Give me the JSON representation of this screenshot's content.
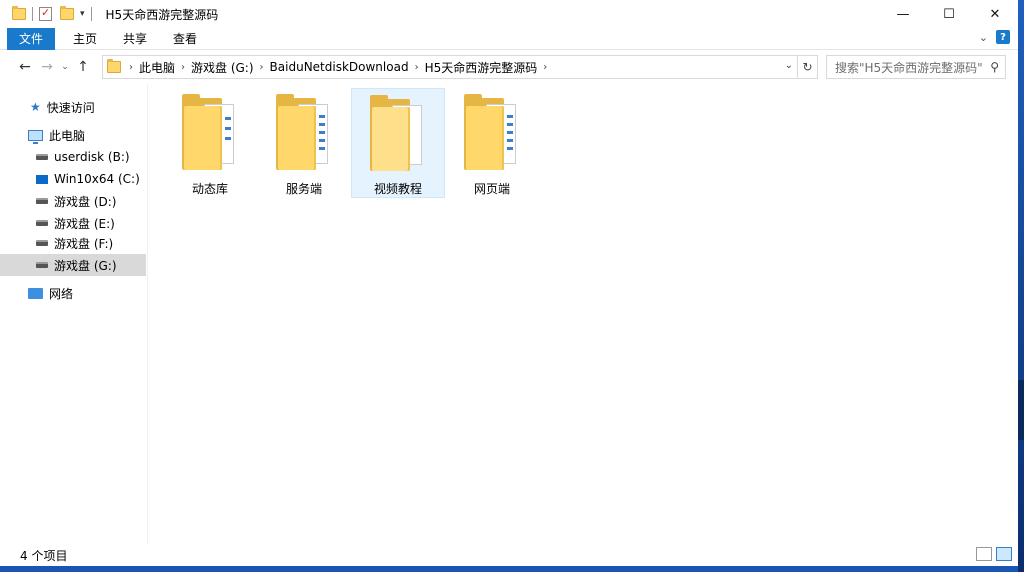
{
  "window": {
    "title": "H5天命西游完整源码",
    "controls": [
      "minimize-icon",
      "maximize-icon",
      "close-icon"
    ]
  },
  "ribbon": {
    "tabs": [
      "文件",
      "主页",
      "共享",
      "查看"
    ]
  },
  "address": {
    "crumbs": [
      "此电脑",
      "游戏盘 (G:)",
      "BaiduNetdiskDownload",
      "H5天命西游完整源码"
    ]
  },
  "search": {
    "placeholder": "搜索\"H5天命西游完整源码\""
  },
  "sidebar": {
    "quick_access": "快速访问",
    "this_pc": "此电脑",
    "drives": [
      {
        "label": "userdisk (B:)"
      },
      {
        "label": "Win10x64 (C:)"
      },
      {
        "label": "游戏盘 (D:)"
      },
      {
        "label": "游戏盘 (E:)"
      },
      {
        "label": "游戏盘 (F:)"
      },
      {
        "label": "游戏盘 (G:)",
        "selected": true
      }
    ],
    "network": "网络"
  },
  "items": [
    {
      "name": "动态库"
    },
    {
      "name": "服务端"
    },
    {
      "name": "视频教程",
      "highlighted": true
    },
    {
      "name": "网页端"
    }
  ],
  "status": {
    "count": "4 个项目"
  },
  "colors": {
    "accent": "#1979ca",
    "folder": "#ffd76b",
    "selection": "#e5f3ff"
  }
}
